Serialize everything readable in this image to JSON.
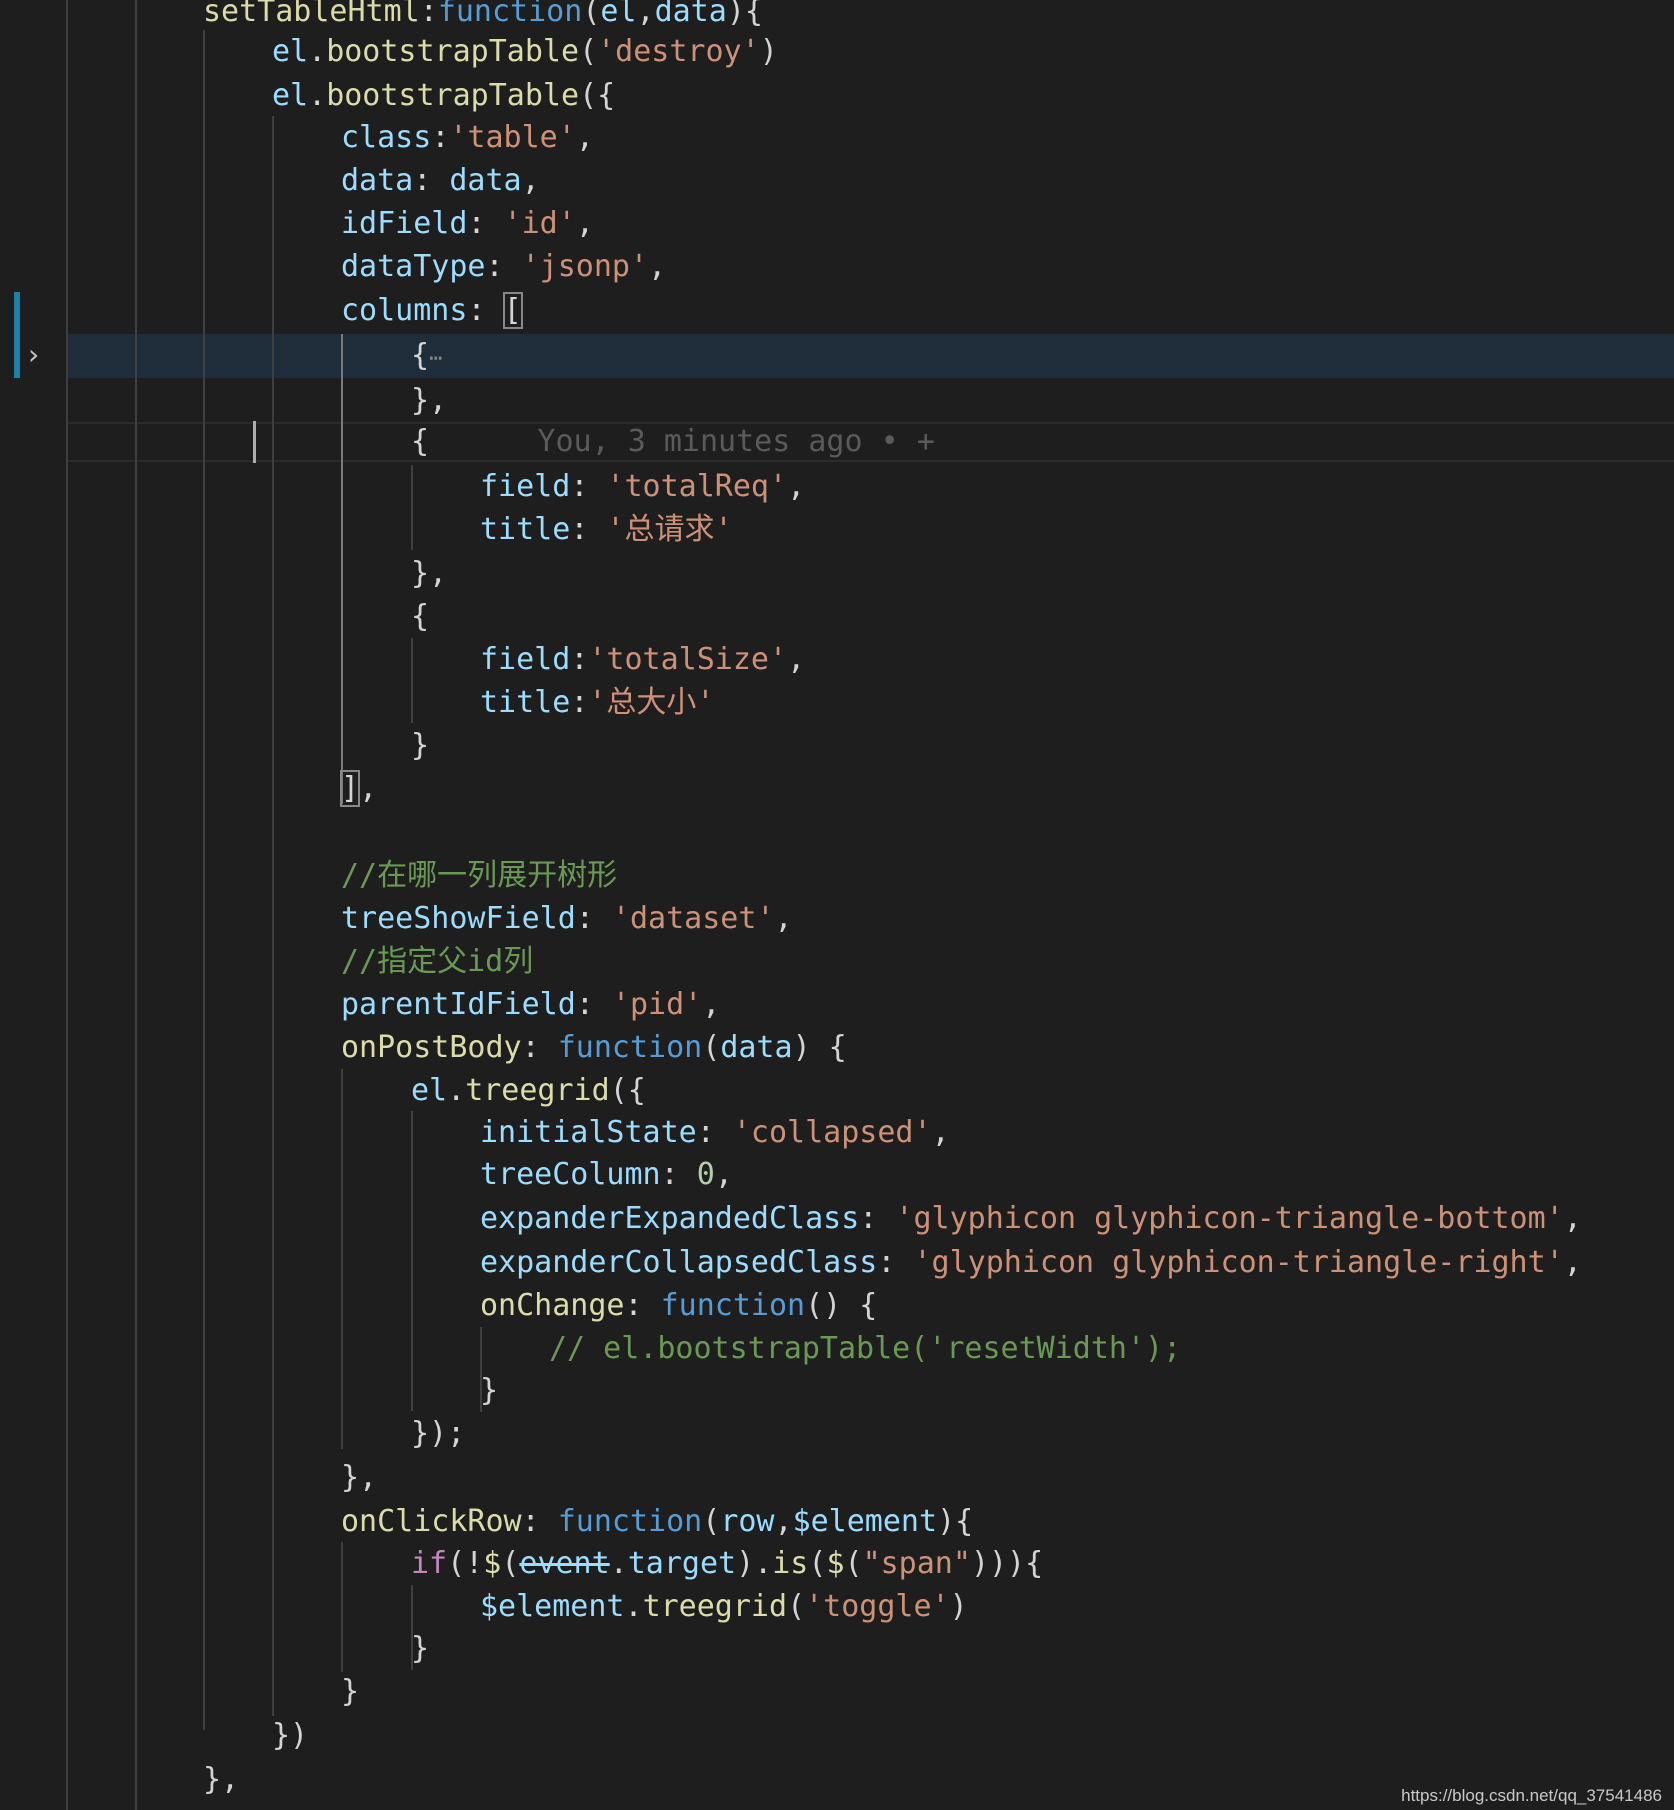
{
  "editor": {
    "lines": [
      {
        "id": "line-set-table-html",
        "tokens": [
          [
            "fn",
            "setTableHtml"
          ],
          [
            "p",
            ":"
          ],
          [
            "kw",
            "function"
          ],
          [
            "p",
            "("
          ],
          [
            "param",
            "el"
          ],
          [
            "p",
            ","
          ],
          [
            "param",
            "data"
          ],
          [
            "p",
            "){"
          ]
        ]
      },
      {
        "id": "line-destroy",
        "tokens": [
          [
            "var",
            "el"
          ],
          [
            "p",
            "."
          ],
          [
            "fn",
            "bootstrapTable"
          ],
          [
            "p",
            "("
          ],
          [
            "str",
            "'destroy'"
          ],
          [
            "p",
            ")"
          ]
        ]
      },
      {
        "id": "line-bootstrap-table",
        "tokens": [
          [
            "var",
            "el"
          ],
          [
            "p",
            "."
          ],
          [
            "fn",
            "bootstrapTable"
          ],
          [
            "p",
            "({"
          ]
        ]
      },
      {
        "id": "line-class",
        "tokens": [
          [
            "prop",
            "class"
          ],
          [
            "p",
            ":"
          ],
          [
            "str",
            "'table'"
          ],
          [
            "p",
            ","
          ]
        ]
      },
      {
        "id": "line-data",
        "tokens": [
          [
            "prop",
            "data"
          ],
          [
            "p",
            ": "
          ],
          [
            "var",
            "data"
          ],
          [
            "p",
            ","
          ]
        ]
      },
      {
        "id": "line-idfield",
        "tokens": [
          [
            "prop",
            "idField"
          ],
          [
            "p",
            ": "
          ],
          [
            "str",
            "'id'"
          ],
          [
            "p",
            ","
          ]
        ]
      },
      {
        "id": "line-datatype",
        "tokens": [
          [
            "prop",
            "dataType"
          ],
          [
            "p",
            ": "
          ],
          [
            "str",
            "'jsonp'"
          ],
          [
            "p",
            ","
          ]
        ]
      },
      {
        "id": "line-columns",
        "tokens": [
          [
            "prop",
            "columns"
          ],
          [
            "p",
            ": "
          ],
          [
            "box",
            "["
          ]
        ]
      },
      {
        "id": "line-folded-object",
        "tokens": [
          [
            "p",
            "{"
          ],
          [
            "dots",
            "⋯"
          ]
        ]
      },
      {
        "id": "line-folded-close",
        "tokens": [
          [
            "p",
            "},"
          ]
        ]
      },
      {
        "id": "line-object-open",
        "tokens": [
          [
            "p",
            "{"
          ],
          [
            "blame",
            "      You, 3 minutes ago • +"
          ]
        ]
      },
      {
        "id": "line-field-totalreq",
        "tokens": [
          [
            "prop",
            "field"
          ],
          [
            "p",
            ": "
          ],
          [
            "str",
            "'totalReq'"
          ],
          [
            "p",
            ","
          ]
        ]
      },
      {
        "id": "line-title-zongqingqiu",
        "tokens": [
          [
            "prop",
            "title"
          ],
          [
            "p",
            ": "
          ],
          [
            "str",
            "'总请求'"
          ]
        ]
      },
      {
        "id": "line-object-close-1",
        "tokens": [
          [
            "p",
            "},"
          ]
        ]
      },
      {
        "id": "line-object-open-2",
        "tokens": [
          [
            "p",
            "{"
          ]
        ]
      },
      {
        "id": "line-field-totalsize",
        "tokens": [
          [
            "prop",
            "field"
          ],
          [
            "p",
            ":"
          ],
          [
            "str",
            "'totalSize'"
          ],
          [
            "p",
            ","
          ]
        ]
      },
      {
        "id": "line-title-zongdaxiao",
        "tokens": [
          [
            "prop",
            "title"
          ],
          [
            "p",
            ":"
          ],
          [
            "str",
            "'总大小'"
          ]
        ]
      },
      {
        "id": "line-object-close-2",
        "tokens": [
          [
            "p",
            "}"
          ]
        ]
      },
      {
        "id": "line-columns-close",
        "tokens": [
          [
            "box",
            "]"
          ],
          [
            "p",
            ","
          ]
        ]
      },
      {
        "id": "line-empty",
        "tokens": []
      },
      {
        "id": "line-comment-tree-column",
        "tokens": [
          [
            "cm",
            "//在哪一列展开树形"
          ]
        ]
      },
      {
        "id": "line-treeshowfield",
        "tokens": [
          [
            "prop",
            "treeShowField"
          ],
          [
            "p",
            ": "
          ],
          [
            "str",
            "'dataset'"
          ],
          [
            "p",
            ","
          ]
        ]
      },
      {
        "id": "line-comment-parent-id",
        "tokens": [
          [
            "cm",
            "//指定父id列"
          ]
        ]
      },
      {
        "id": "line-parentidfield",
        "tokens": [
          [
            "prop",
            "parentIdField"
          ],
          [
            "p",
            ": "
          ],
          [
            "str",
            "'pid'"
          ],
          [
            "p",
            ","
          ]
        ]
      },
      {
        "id": "line-onpostbody",
        "tokens": [
          [
            "fn",
            "onPostBody"
          ],
          [
            "p",
            ": "
          ],
          [
            "kw",
            "function"
          ],
          [
            "p",
            "("
          ],
          [
            "param",
            "data"
          ],
          [
            "p",
            ") {"
          ]
        ]
      },
      {
        "id": "line-treegrid",
        "tokens": [
          [
            "var",
            "el"
          ],
          [
            "p",
            "."
          ],
          [
            "fn",
            "treegrid"
          ],
          [
            "p",
            "({"
          ]
        ]
      },
      {
        "id": "line-initialstate",
        "tokens": [
          [
            "prop",
            "initialState"
          ],
          [
            "p",
            ": "
          ],
          [
            "str",
            "'collapsed'"
          ],
          [
            "p",
            ","
          ]
        ]
      },
      {
        "id": "line-treecolumn",
        "tokens": [
          [
            "prop",
            "treeColumn"
          ],
          [
            "p",
            ": "
          ],
          [
            "num",
            "0"
          ],
          [
            "p",
            ","
          ]
        ]
      },
      {
        "id": "line-expanded-class",
        "tokens": [
          [
            "prop",
            "expanderExpandedClass"
          ],
          [
            "p",
            ": "
          ],
          [
            "str",
            "'glyphicon glyphicon-triangle-bottom'"
          ],
          [
            "p",
            ","
          ]
        ]
      },
      {
        "id": "line-collapsed-class",
        "tokens": [
          [
            "prop",
            "expanderCollapsedClass"
          ],
          [
            "p",
            ": "
          ],
          [
            "str",
            "'glyphicon glyphicon-triangle-right'"
          ],
          [
            "p",
            ","
          ]
        ]
      },
      {
        "id": "line-onchange",
        "tokens": [
          [
            "fn",
            "onChange"
          ],
          [
            "p",
            ": "
          ],
          [
            "kw",
            "function"
          ],
          [
            "p",
            "() {"
          ]
        ]
      },
      {
        "id": "line-comment-reset-width",
        "tokens": [
          [
            "cm",
            "// el.bootstrapTable('resetWidth');"
          ]
        ]
      },
      {
        "id": "line-onchange-close",
        "tokens": [
          [
            "p",
            "}"
          ]
        ]
      },
      {
        "id": "line-treegrid-close",
        "tokens": [
          [
            "p",
            "});"
          ]
        ]
      },
      {
        "id": "line-onpostbody-close",
        "tokens": [
          [
            "p",
            "},"
          ]
        ]
      },
      {
        "id": "line-onclickrow",
        "tokens": [
          [
            "fn",
            "onClickRow"
          ],
          [
            "p",
            ": "
          ],
          [
            "kw",
            "function"
          ],
          [
            "p",
            "("
          ],
          [
            "param",
            "row"
          ],
          [
            "p",
            ","
          ],
          [
            "param",
            "$element"
          ],
          [
            "p",
            "){"
          ]
        ]
      },
      {
        "id": "line-if-event-target",
        "tokens": [
          [
            "ctl",
            "if"
          ],
          [
            "p",
            "(!"
          ],
          [
            "fn",
            "$"
          ],
          [
            "p",
            "("
          ],
          [
            "dep",
            "event"
          ],
          [
            "p",
            "."
          ],
          [
            "prop",
            "target"
          ],
          [
            "p",
            ")."
          ],
          [
            "fn",
            "is"
          ],
          [
            "p",
            "("
          ],
          [
            "fn",
            "$"
          ],
          [
            "p",
            "("
          ],
          [
            "str",
            "\"span\""
          ],
          [
            "p",
            ")))"
          ],
          [
            "p",
            "{"
          ]
        ]
      },
      {
        "id": "line-treegrid-toggle",
        "tokens": [
          [
            "var",
            "$element"
          ],
          [
            "p",
            "."
          ],
          [
            "fn",
            "treegrid"
          ],
          [
            "p",
            "("
          ],
          [
            "str",
            "'toggle'"
          ],
          [
            "p",
            ")"
          ]
        ]
      },
      {
        "id": "line-if-close",
        "tokens": [
          [
            "p",
            "}"
          ]
        ]
      },
      {
        "id": "line-onclickrow-close",
        "tokens": [
          [
            "p",
            "}"
          ]
        ]
      },
      {
        "id": "line-bootstrap-close",
        "tokens": [
          [
            "p",
            "})"
          ]
        ]
      },
      {
        "id": "line-settable-close",
        "tokens": [
          [
            "p",
            "},"
          ]
        ]
      }
    ]
  },
  "watermark": "https://blog.csdn.net/qq_37541486"
}
